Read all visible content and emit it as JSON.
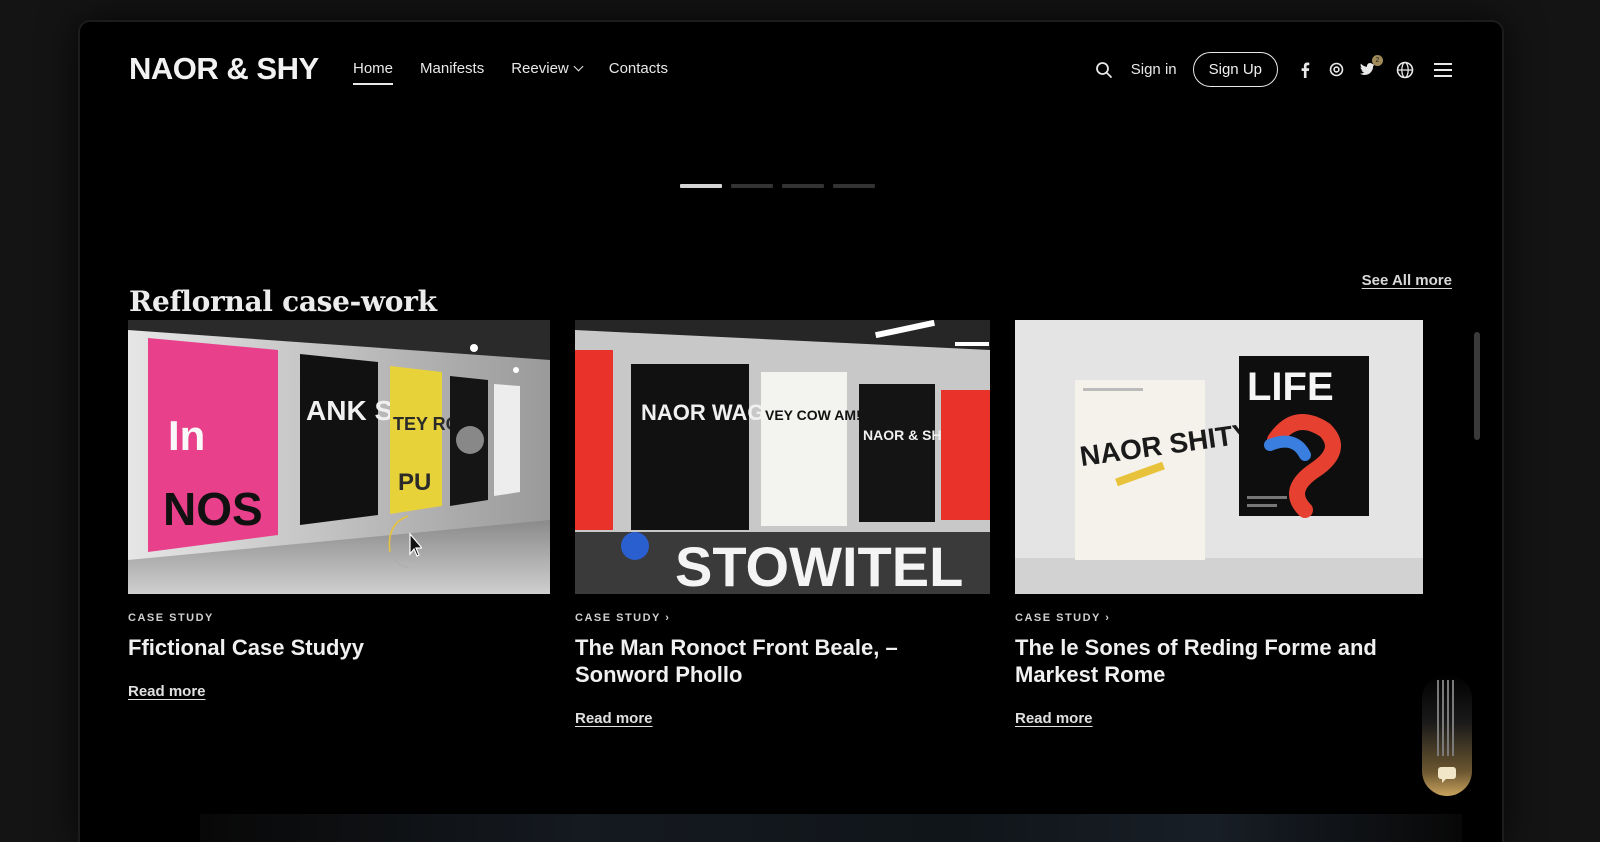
{
  "brand": {
    "logo": "NAOR & SHY"
  },
  "nav": {
    "items": [
      {
        "label": "Home",
        "active": true
      },
      {
        "label": "Manifests",
        "active": false
      },
      {
        "label": "Reeview",
        "active": false,
        "dropdown": true
      },
      {
        "label": "Contacts",
        "active": false
      }
    ]
  },
  "header_tools": {
    "sign_in": "Sign in",
    "sign_up": "Sign Up",
    "social_icons": [
      "facebook-icon",
      "instagram-icon",
      "twitter-icon"
    ],
    "notification_count": "2",
    "language_icon": "globe-icon",
    "menu_icon": "hamburger-icon",
    "search_icon": "search-icon"
  },
  "slider": {
    "dots": 4,
    "active_index": 0
  },
  "section": {
    "title": "Reflornal case-work",
    "see_all": "See All more"
  },
  "cards": [
    {
      "tag": "CASE STUDY",
      "title": "Ffictional Case Studyy",
      "link": "Read more",
      "poster_texts": [
        "In",
        "NOS",
        "ANK SOF",
        "TEY ROR",
        "PU"
      ]
    },
    {
      "tag": "CASE STUDY ›",
      "title": "The Man Ronoct Front Beale, – Sonword Phollo",
      "link": "Read more",
      "poster_texts": [
        "NAOR WAGHT SHY",
        "VEY COW AM!",
        "NAOR & SHY",
        "STOWITEL"
      ]
    },
    {
      "tag": "CASE STUDY ›",
      "title": "The le Sones of Reding Forme and Markest Rome",
      "link": "Read more",
      "poster_texts": [
        "NAOR SHITY",
        "LIFE"
      ]
    }
  ],
  "colors": {
    "background": "#000000",
    "text": "#f0f0f0",
    "accent_gold": "#c9a35e",
    "poster_pink": "#e8408a",
    "poster_yellow": "#e8d23a",
    "poster_red": "#e8322a"
  }
}
